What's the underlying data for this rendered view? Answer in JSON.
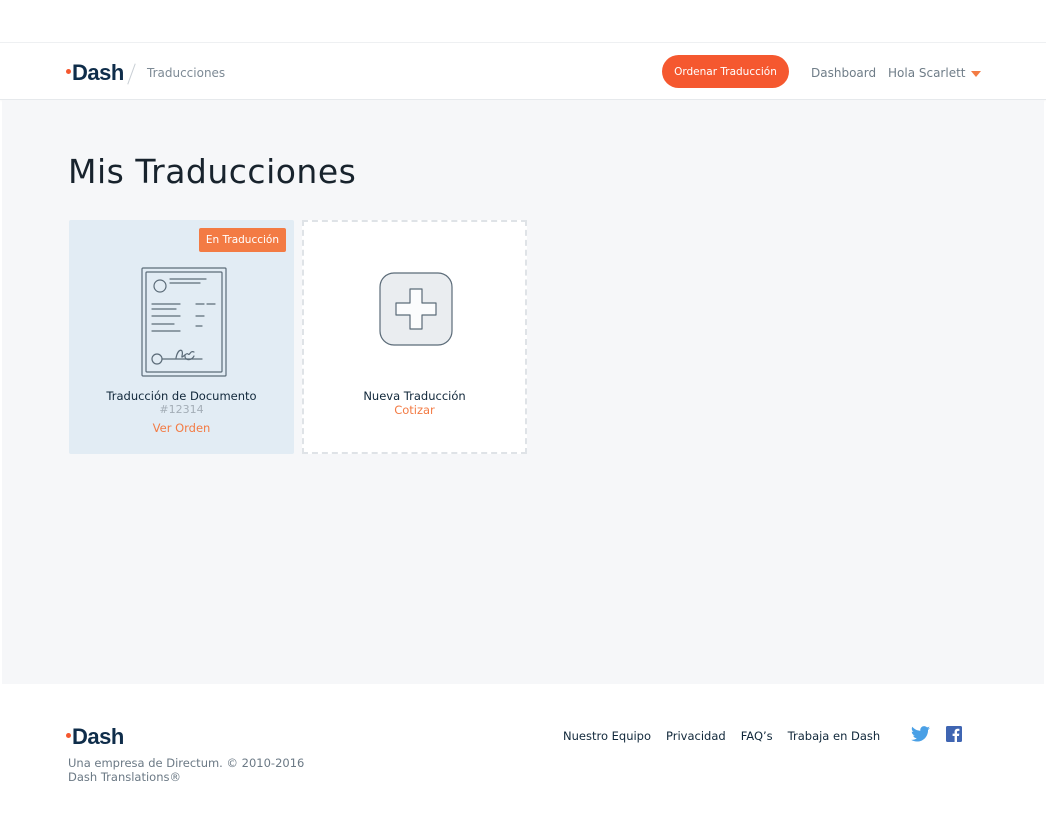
{
  "colors": {
    "accent": "#f5582f",
    "accent_text": "#f37b44",
    "brand_navy": "#0f2d4a",
    "twitter": "#4aa0e6",
    "facebook": "#3f65b2"
  },
  "header": {
    "logo_text": "Dash",
    "breadcrumb": "Traducciones",
    "order_button": "Ordenar Traducción",
    "nav_dashboard": "Dashboard",
    "nav_user": "Hola Scarlett",
    "user_icon": "caret-down-icon"
  },
  "main": {
    "title": "Mis Traducciones",
    "cards": [
      {
        "status_badge": "En Traducción",
        "icon": "document-icon",
        "title": "Traducción de Documento",
        "number": "#12314",
        "link": "Ver Orden"
      },
      {
        "icon": "plus-icon",
        "title": "Nueva Traducción",
        "link": "Cotizar"
      }
    ]
  },
  "footer": {
    "logo_text": "Dash",
    "company_line": "Una empresa de Directum. © 2010-2016",
    "trademark_line": "Dash Translations®",
    "links": [
      "Nuestro Equipo",
      "Privacidad",
      "FAQ’s",
      "Trabaja en Dash"
    ],
    "social": [
      "twitter-icon",
      "facebook-icon"
    ]
  }
}
